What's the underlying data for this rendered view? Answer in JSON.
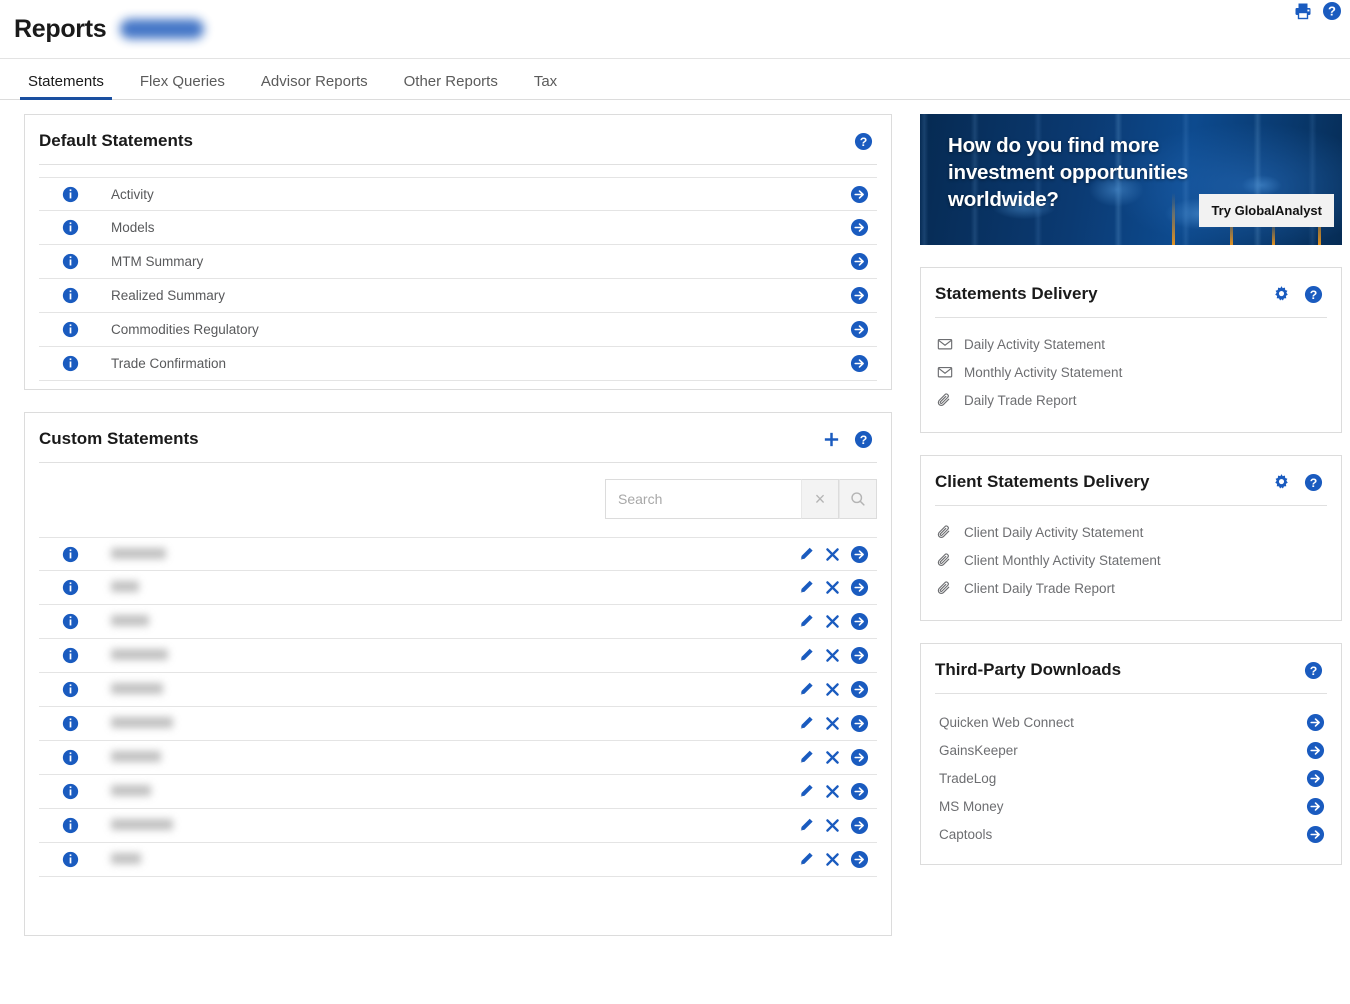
{
  "header": {
    "title": "Reports",
    "account_badge_redacted": true,
    "actions": [
      {
        "name": "print-icon",
        "label": "Print"
      },
      {
        "name": "help-icon",
        "label": "Help"
      }
    ]
  },
  "tabs": [
    {
      "label": "Statements",
      "active": true
    },
    {
      "label": "Flex Queries",
      "active": false
    },
    {
      "label": "Advisor Reports",
      "active": false
    },
    {
      "label": "Other Reports",
      "active": false
    },
    {
      "label": "Tax",
      "active": false
    }
  ],
  "default_statements": {
    "title": "Default Statements",
    "help_label": "Help",
    "items": [
      {
        "label": "Activity"
      },
      {
        "label": "Models"
      },
      {
        "label": "MTM Summary"
      },
      {
        "label": "Realized Summary"
      },
      {
        "label": "Commodities Regulatory"
      },
      {
        "label": "Trade Confirmation"
      }
    ]
  },
  "custom_statements": {
    "title": "Custom Statements",
    "add_label": "Add",
    "help_label": "Help",
    "search": {
      "value": "",
      "placeholder": "Search",
      "clear_label": "×",
      "submit_label": "Search"
    },
    "rows": [
      {
        "label": "",
        "redacted": true,
        "redacted_width": 55
      },
      {
        "label": "",
        "redacted": true,
        "redacted_width": 28
      },
      {
        "label": "",
        "redacted": true,
        "redacted_width": 38
      },
      {
        "label": "",
        "redacted": true,
        "redacted_width": 57
      },
      {
        "label": "",
        "redacted": true,
        "redacted_width": 52
      },
      {
        "label": "",
        "redacted": true,
        "redacted_width": 62
      },
      {
        "label": "",
        "redacted": true,
        "redacted_width": 50
      },
      {
        "label": "",
        "redacted": true,
        "redacted_width": 40
      },
      {
        "label": "",
        "redacted": true,
        "redacted_width": 62
      },
      {
        "label": "",
        "redacted": true,
        "redacted_width": 30
      }
    ],
    "row_actions": [
      {
        "name": "edit-icon",
        "label": "Edit"
      },
      {
        "name": "delete-icon",
        "label": "Delete"
      },
      {
        "name": "go-arrow-icon",
        "label": "Open"
      }
    ]
  },
  "banner": {
    "headline": "How do you find more investment opportunities worldwide?",
    "cta": "Try GlobalAnalyst"
  },
  "statements_delivery": {
    "title": "Statements Delivery",
    "settings_label": "Settings",
    "help_label": "Help",
    "items": [
      {
        "label": "Daily Activity Statement",
        "icon": "envelope-icon"
      },
      {
        "label": "Monthly Activity Statement",
        "icon": "envelope-icon"
      },
      {
        "label": "Daily Trade Report",
        "icon": "paperclip-icon"
      }
    ]
  },
  "client_statements_delivery": {
    "title": "Client Statements Delivery",
    "settings_label": "Settings",
    "help_label": "Help",
    "items": [
      {
        "label": "Client Daily Activity Statement",
        "icon": "paperclip-icon"
      },
      {
        "label": "Client Monthly Activity Statement",
        "icon": "paperclip-icon"
      },
      {
        "label": "Client Daily Trade Report",
        "icon": "paperclip-icon"
      }
    ]
  },
  "third_party_downloads": {
    "title": "Third-Party Downloads",
    "help_label": "Help",
    "items": [
      {
        "label": "Quicken Web Connect"
      },
      {
        "label": "GainsKeeper"
      },
      {
        "label": "TradeLog"
      },
      {
        "label": "MS Money"
      },
      {
        "label": "Captools"
      }
    ]
  },
  "colors": {
    "accent_blue": "#1a5bbf",
    "tab_underline": "#1a4fa0",
    "text_primary": "#1a1a1a",
    "text_muted": "#6d6e71",
    "border": "#dcdcdc",
    "banner_dark": "#062a52",
    "banner_accent": "#eb961e"
  }
}
